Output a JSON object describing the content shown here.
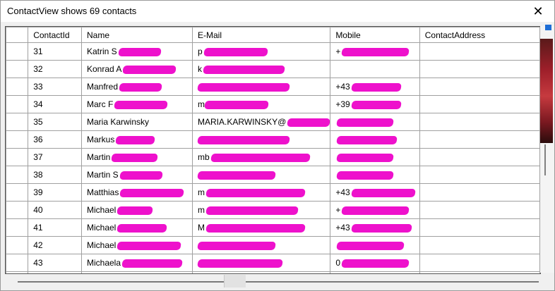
{
  "window": {
    "title": "ContactView shows 69 contacts",
    "close_glyph": "✕"
  },
  "grid": {
    "columns": [
      "",
      "ContactId",
      "Name",
      "E-Mail",
      "Mobile",
      "ContactAddress"
    ],
    "rows": [
      {
        "id": "31",
        "name": "Katrin S",
        "email": "p",
        "mobile": "+",
        "address": ""
      },
      {
        "id": "32",
        "name": "Konrad A",
        "email": "k",
        "mobile": "",
        "address": ""
      },
      {
        "id": "33",
        "name": "Manfred",
        "email": "",
        "mobile": "+43",
        "address": ""
      },
      {
        "id": "34",
        "name": "Marc F",
        "email": "m",
        "mobile": "+39",
        "address": ""
      },
      {
        "id": "35",
        "name": "Maria Karwinsky",
        "email": "MARIA.KARWINSKY@",
        "mobile": "",
        "address": ""
      },
      {
        "id": "36",
        "name": "Markus",
        "email": "",
        "mobile": "",
        "address": ""
      },
      {
        "id": "37",
        "name": "Martin",
        "email": "mb",
        "mobile": "",
        "address": ""
      },
      {
        "id": "38",
        "name": "Martin S",
        "email": "",
        "mobile": "",
        "address": ""
      },
      {
        "id": "39",
        "name": "Matthias",
        "email": "m",
        "mobile": "+43",
        "address": ""
      },
      {
        "id": "40",
        "name": "Michael",
        "email": "m",
        "mobile": "+",
        "address": ""
      },
      {
        "id": "41",
        "name": "Michael",
        "email": "M",
        "mobile": "+43",
        "address": ""
      },
      {
        "id": "42",
        "name": "Michael",
        "email": "",
        "mobile": "",
        "address": ""
      },
      {
        "id": "43",
        "name": "Michaela",
        "email": "",
        "mobile": "0",
        "address": ""
      },
      {
        "id": "",
        "name": "",
        "email": "",
        "mobile": "",
        "address": ""
      }
    ]
  },
  "redaction_color": "#ee11cc",
  "icons": {
    "close": "close-icon"
  }
}
